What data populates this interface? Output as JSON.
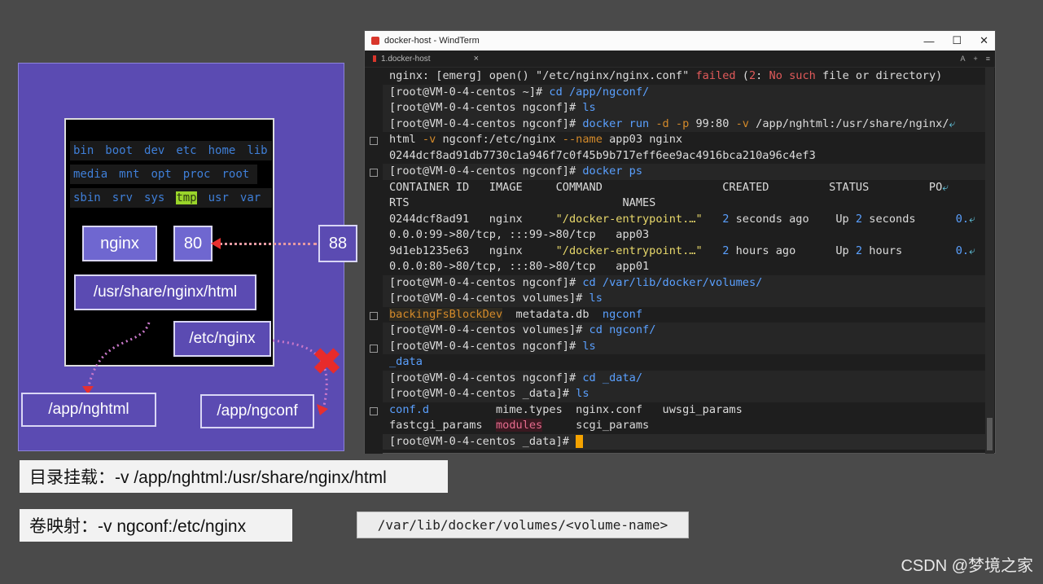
{
  "diagram": {
    "rows": [
      [
        "bin",
        "boot",
        "dev",
        "etc",
        "home",
        "lib"
      ],
      [
        "media",
        "mnt",
        "opt",
        "proc",
        "root"
      ],
      [
        "sbin",
        "srv",
        "sys",
        "tmp",
        "usr",
        "var"
      ]
    ],
    "highlight": "tmp",
    "nginx_box": "nginx",
    "port_box": "80",
    "host_port_box": "88",
    "html_path": "/usr/share/nginx/html",
    "etc_path": "/etc/nginx",
    "app_nghtml": "/app/nghtml",
    "app_ngconf": "/app/ngconf"
  },
  "captions": {
    "mount": "目录挂载：-v /app/nghtml:/usr/share/nginx/html",
    "volume": "卷映射：-v ngconf:/etc/nginx",
    "volume_path": "/var/lib/docker/volumes/<volume-name>"
  },
  "window": {
    "title": "docker-host - WindTerm",
    "tab": "1.docker-host",
    "tab_close": "×",
    "controls": [
      "—",
      "☐",
      "✕"
    ],
    "tab_right": [
      "A",
      "+",
      "≡"
    ]
  },
  "terminal": {
    "l1": {
      "a": "nginx: [emerg] open() \"/etc/nginx/nginx.conf\" ",
      "b": "failed",
      "c": " (",
      "d": "2",
      "e": ": ",
      "f": "No such",
      "g": " file or directory)"
    },
    "prompt_home": "[root@VM-0-4-centos ~]# ",
    "prompt_ngconf": "[root@VM-0-4-centos ngconf]# ",
    "prompt_volumes": "[root@VM-0-4-centos volumes]# ",
    "prompt_data": "[root@VM-0-4-centos _data]# ",
    "cmd_cd_app": "cd /app/ngconf/",
    "cmd_ls": "ls",
    "cmd_run1": "docker run ",
    "opt_d": "-d",
    "opt_p": " -p ",
    "run_ports": "99:80",
    "opt_v": " -v ",
    "run_vol": "/app/nghtml:/usr/share/nginx/",
    "wrap": "⤶",
    "run_cont1": "html ",
    "opt_v2": "-v",
    "run_vol2": " ngconf:/etc/nginx ",
    "opt_name": "--name",
    "run_name": " app03 nginx",
    "container_id": "0244dcf8ad91db7730c1a946f7c0f45b9b717eff6ee9ac4916bca210a96c4ef3",
    "cmd_ps": "docker ps",
    "ps_header": "CONTAINER ID   IMAGE     COMMAND                  CREATED         STATUS         PO",
    "ps_header2": "RTS                                NAMES",
    "r1_id": "0244dcf8ad91   nginx     ",
    "r1_cmd": "\"/docker-entrypoint.…\"",
    "r1_created_a": "   ",
    "r1_num": "2",
    "r1_created_b": " seconds ago    Up ",
    "r1_up_num": "2",
    "r1_up_b": " seconds      ",
    "r1_po": "0.",
    "r1_ports": "0.0.0:99->80/tcp, :::99->80/tcp   app03",
    "r2_id": "9d1eb1235e63   nginx     ",
    "r2_cmd": "\"/docker-entrypoint.…\"",
    "r2_created_a": "   ",
    "r2_num": "2",
    "r2_created_b": " hours ago      Up ",
    "r2_up_num": "2",
    "r2_up_b": " hours        ",
    "r2_po": "0.",
    "r2_ports": "0.0.0:80->80/tcp, :::80->80/tcp   app01",
    "cmd_cd_vol": "cd /var/lib/docker/volumes/",
    "vol_ls_a": "backingFsBlockDev",
    "vol_ls_b": "  metadata.db  ",
    "vol_ls_c": "ngconf",
    "cmd_cd_ngconf": "cd ngconf/",
    "data_dir": "_data",
    "cmd_cd_data": "cd _data/",
    "ls1_a": "conf.d",
    "ls1_b": "          mime.types  nginx.conf   uwsgi_params",
    "ls2_a": "fastcgi_params  ",
    "ls2_b": "modules",
    "ls2_c": "     scgi_params"
  },
  "watermark": "CSDN @梦境之家"
}
